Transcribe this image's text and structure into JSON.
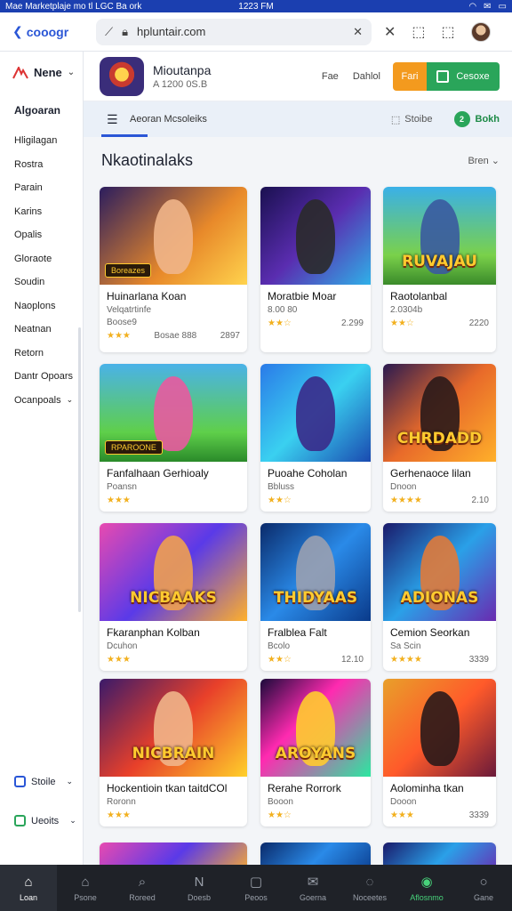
{
  "status": {
    "left": "Mae Marketplaje mo tl LGC Ba ork",
    "time": "1223 FM"
  },
  "browser": {
    "brand": "cooogr",
    "url": "hpluntair.com"
  },
  "sidebar": {
    "menu_label": "Nene",
    "heading": "Algoaran",
    "items": [
      {
        "label": "Hligilagan"
      },
      {
        "label": "Rostra"
      },
      {
        "label": "Parain"
      },
      {
        "label": "Karins"
      },
      {
        "label": "Opalis"
      },
      {
        "label": "Gloraote"
      },
      {
        "label": "Soudin"
      },
      {
        "label": "Naoplons"
      },
      {
        "label": "Neatnan"
      },
      {
        "label": "Retorn"
      },
      {
        "label": "Dantr Opoars"
      },
      {
        "label": "Ocanpoals"
      }
    ],
    "bottom1": "Stoile",
    "bottom2": "Ueoits"
  },
  "header": {
    "app_name": "Mioutanpa",
    "app_sub": "A 1200 0S.B",
    "link1": "Fae",
    "link2": "Dahlol",
    "btn_orange": "Fari",
    "btn_green": "Cesoxe"
  },
  "subbar": {
    "title": "Aeoran Mcsoleiks",
    "store": "Stoibe",
    "badge": "Bokh",
    "badge_num": "2"
  },
  "section": {
    "title": "Nkaotinalaks",
    "filter": "Bren"
  },
  "cards": [
    {
      "title": "Huinarlana Koan",
      "sub": "Velqatrtinfe",
      "meta": "Boose9",
      "extra": "Bosae 888",
      "price": "2897",
      "stars": 3,
      "label": "",
      "badge": "Boreazes"
    },
    {
      "title": "Moratbie Moar",
      "sub": "",
      "meta": "8.00 80",
      "extra": "",
      "price": "2.299",
      "stars": 2,
      "label": "",
      "badge": ""
    },
    {
      "title": "Raotolanbal",
      "sub": "",
      "meta": "2.0304b",
      "extra": "",
      "price": "2220",
      "stars": 2,
      "label": "RUVAJAU",
      "badge": ""
    },
    {
      "title": "Fanfalhaan Gerhioaly",
      "sub": "Poansn",
      "meta": "",
      "extra": "",
      "price": "",
      "stars": 3,
      "label": "",
      "badge": "RPAROONE"
    },
    {
      "title": "Puoahe Coholan",
      "sub": "Bbluss",
      "meta": "",
      "extra": "",
      "price": "",
      "stars": 2,
      "label": "",
      "badge": ""
    },
    {
      "title": "Gerhenaoce lilan",
      "sub": "Dnoon",
      "meta": "",
      "extra": "",
      "price": "2.10",
      "stars": 4,
      "label": "CHRDADD",
      "badge": ""
    },
    {
      "title": "Fkaranphan Kolban",
      "sub": "Dcuhon",
      "meta": "",
      "extra": "",
      "price": "",
      "stars": 3,
      "label": "NICBAAKS",
      "badge": ""
    },
    {
      "title": "Fralblea Falt",
      "sub": "Bcolo",
      "meta": "",
      "extra": "",
      "price": "12.10",
      "stars": 2,
      "label": "THIDYAAS",
      "badge": ""
    },
    {
      "title": "Cemion Seorkan",
      "sub": "Sa Scin",
      "meta": "",
      "extra": "",
      "price": "3339",
      "stars": 4,
      "label": "ADIONAS",
      "badge": ""
    },
    {
      "title": "Hockentioin tkan taitdCOl",
      "sub": "Roronn",
      "meta": "",
      "extra": "",
      "price": "",
      "stars": 3,
      "label": "NICBRAIN",
      "badge": ""
    },
    {
      "title": "Rerahe Rorrork",
      "sub": "Booon",
      "meta": "",
      "extra": "",
      "price": "",
      "stars": 2,
      "label": "AROYANS",
      "badge": ""
    },
    {
      "title": "Aolominha tkan",
      "sub": "Dooon",
      "meta": "",
      "extra": "",
      "price": "3339",
      "stars": 3,
      "label": "",
      "badge": ""
    }
  ],
  "bottomnav": [
    {
      "label": "Loan",
      "icon": "home-icon"
    },
    {
      "label": "Psone",
      "icon": "house-icon"
    },
    {
      "label": "Roreed",
      "icon": "search-icon"
    },
    {
      "label": "Doesb",
      "icon": "n-icon"
    },
    {
      "label": "Peoos",
      "icon": "bag-icon"
    },
    {
      "label": "Goerna",
      "icon": "mail-icon"
    },
    {
      "label": "Noceetes",
      "icon": "chat-icon"
    },
    {
      "label": "Aflosnmo",
      "icon": "game-icon"
    },
    {
      "label": "Gane",
      "icon": "circle-icon"
    }
  ]
}
